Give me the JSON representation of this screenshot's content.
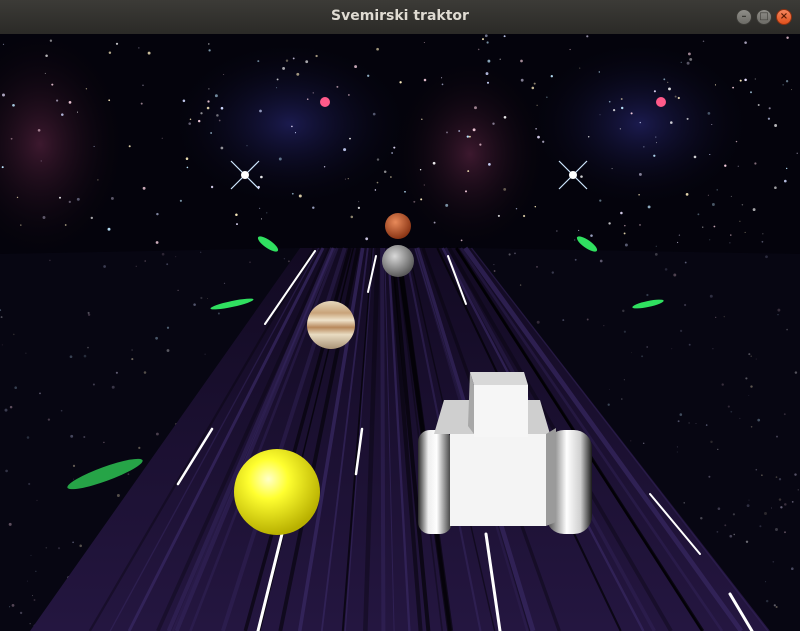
{
  "window": {
    "title": "Svemirski traktor"
  },
  "titlebar_buttons": {
    "minimize_glyph": "–",
    "maximize_glyph": "□",
    "close_glyph": "×"
  },
  "scene": {
    "background": "starfield nebula",
    "road_color": "#1a1030",
    "lane_stripe_color": "#ffffff",
    "objects": [
      {
        "kind": "planet",
        "name": "mars",
        "color": "#c65a33"
      },
      {
        "kind": "planet",
        "name": "moon",
        "color": "#9a9a9a"
      },
      {
        "kind": "planet",
        "name": "jupiter",
        "color": "#d8c6a6"
      },
      {
        "kind": "planet",
        "name": "sun",
        "color": "#ffff20"
      },
      {
        "kind": "player",
        "name": "tractor",
        "color": "#f2f2f2"
      }
    ]
  }
}
